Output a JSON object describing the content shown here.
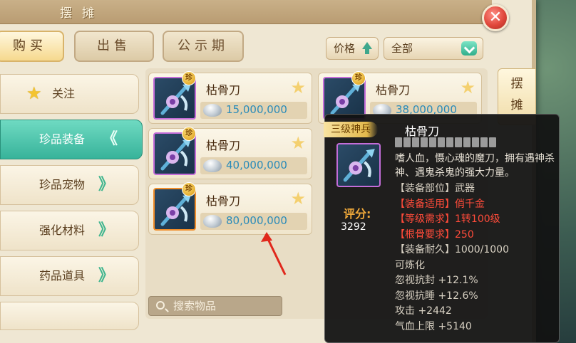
{
  "window": {
    "title": "摆摊",
    "close_glyph": "✕"
  },
  "tabs": [
    {
      "label": "购买",
      "active": true
    },
    {
      "label": "出售",
      "active": false
    },
    {
      "label": "公示期",
      "active": false
    }
  ],
  "sort": {
    "label": "价格",
    "icon": "arrow-up-icon"
  },
  "filter": {
    "value": "全部",
    "icon": "chevron-down-icon"
  },
  "categories": [
    {
      "label": "关注",
      "icon": "star-icon"
    },
    {
      "label": "珍品装备",
      "active": true
    },
    {
      "label": "珍品宠物"
    },
    {
      "label": "强化材料"
    },
    {
      "label": "药品道具"
    }
  ],
  "items": [
    {
      "name": "枯骨刀",
      "price": "15,000,000",
      "badge": "珍"
    },
    {
      "name": "枯骨刀",
      "price": "38,000,000",
      "badge": "珍"
    },
    {
      "name": "枯骨刀",
      "price": "40,000,000",
      "badge": "珍"
    },
    {
      "name": "枯骨刀",
      "price": "80,000,000",
      "badge": "珍"
    }
  ],
  "search": {
    "placeholder": "搜索物品"
  },
  "side_tab": {
    "label": "摆摊"
  },
  "tooltip": {
    "rank": "三级神兵",
    "name": "枯骨刀",
    "score_label": "评分:",
    "score_value": "3292",
    "description": "嗜人血，慑心魂的魔刀，拥有遇神杀神、遇鬼杀鬼的强大力量。",
    "lines": [
      {
        "text": "【装备部位】武器",
        "color": "#d7d0c2"
      },
      {
        "text": "【装备适用】俏千金",
        "color": "#ff4b3a"
      },
      {
        "text": "【等级需求】1转100级",
        "color": "#ff4b3a"
      },
      {
        "text": "【根骨要求】250",
        "color": "#ff4b3a"
      },
      {
        "text": "【装备耐久】1000/1000",
        "color": "#d7d0c2"
      },
      {
        "text": "可炼化",
        "color": "#d7d0c2"
      },
      {
        "text": "忽视抗封 +12.1%",
        "color": "#d7d0c2"
      },
      {
        "text": "忽视抗睡 +12.6%",
        "color": "#d7d0c2"
      },
      {
        "text": "攻击 +2442",
        "color": "#d7d0c2"
      },
      {
        "text": "气血上限 +5140",
        "color": "#d7d0c2"
      }
    ]
  }
}
